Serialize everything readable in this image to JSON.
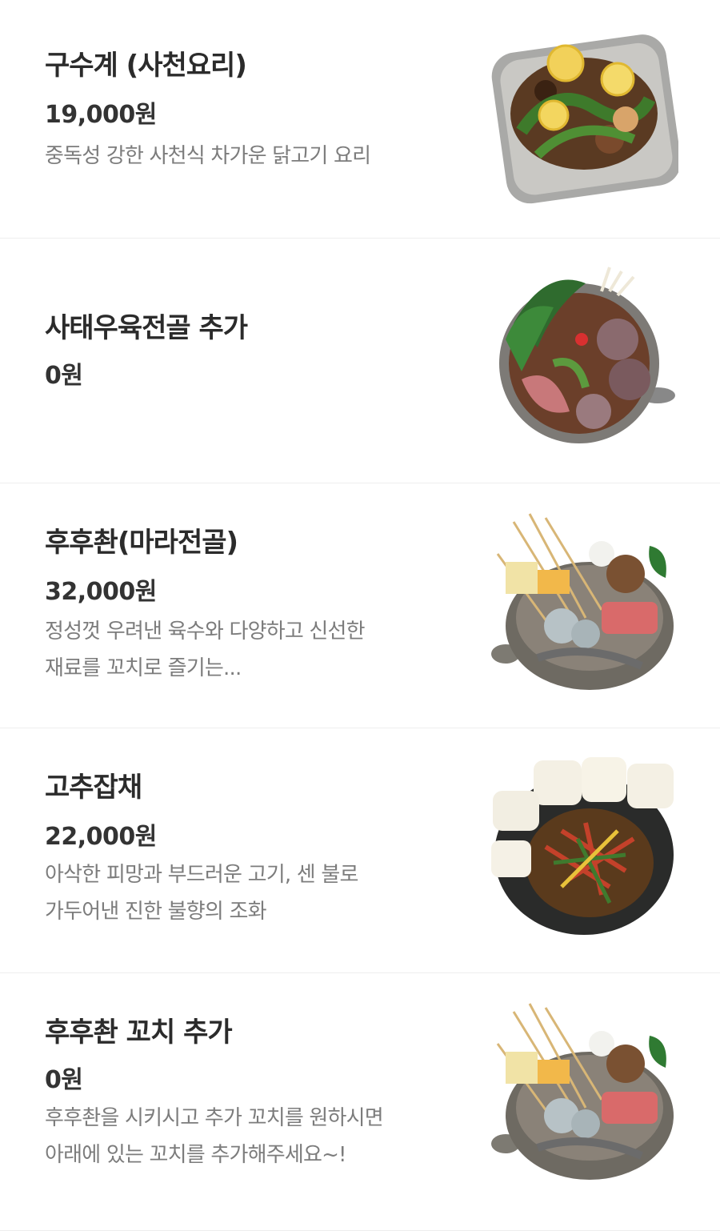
{
  "menu_items": [
    {
      "name": "구수계 (사천요리)",
      "price": "19,000원",
      "description_lines": [
        "중독성 강한 사천식 차가운 닭고기 요리"
      ],
      "image_icon": "spicy-chicken-dish-icon"
    },
    {
      "name": "사태우육전골 추가",
      "price": "0원",
      "description_lines": [],
      "image_icon": "beef-hotpot-icon"
    },
    {
      "name": "후후촨(마라전골)",
      "price": "32,000원",
      "description_lines": [
        "정성껏 우려낸 육수와 다양하고 신선한",
        "재료를 꼬치로 즐기는..."
      ],
      "image_icon": "mala-skewer-hotpot-icon"
    },
    {
      "name": "고추잡채",
      "price": "22,000원",
      "description_lines": [
        "아삭한 피망과 부드러운 고기, 센 불로",
        "가두어낸 진한 불향의 조화"
      ],
      "image_icon": "pepper-japchae-icon"
    },
    {
      "name": "후후촨 꼬치 추가",
      "price": "0원",
      "description_lines": [
        "후후촨을 시키시고 추가 꼬치를 원하시면",
        "아래에 있는 꼬치를 추가해주세요~!"
      ],
      "image_icon": "mala-skewer-hotpot-icon"
    }
  ]
}
